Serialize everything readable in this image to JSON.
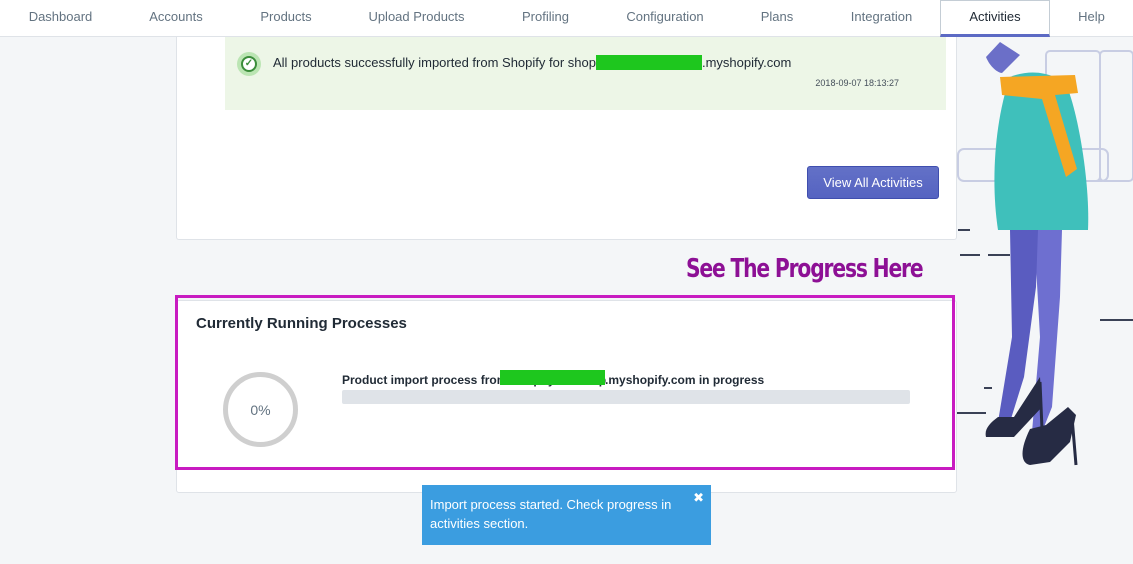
{
  "nav": {
    "items": [
      {
        "label": "Dashboard"
      },
      {
        "label": "Accounts"
      },
      {
        "label": "Products"
      },
      {
        "label": "Upload Products"
      },
      {
        "label": "Profiling"
      },
      {
        "label": "Configuration"
      },
      {
        "label": "Plans"
      },
      {
        "label": "Integration"
      },
      {
        "label": "Activities"
      },
      {
        "label": "Help"
      }
    ],
    "active": "Activities"
  },
  "activity": {
    "message_prefix": "All products successfully imported from Shopify for shop",
    "message_suffix": ".myshopify.com",
    "timestamp": "2018-09-07 18:13:27"
  },
  "view_all_label": "View All Activities",
  "callout": "See The Progress Here",
  "running": {
    "title": "Currently Running Processes",
    "percent_label": "0%",
    "progress": 0,
    "process_prefix": "Product import process from Shopify for shop",
    "process_suffix": ".myshopify.com in progress"
  },
  "toast": {
    "message": "Import process started. Check progress in activities section.",
    "close": "✖"
  },
  "colors": {
    "accent": "#5c6ac4",
    "success_bg": "#edf6e7",
    "highlight_border": "#c81bc1",
    "callout_text": "#8d1095",
    "toast_bg": "#3b9de0",
    "redaction": "#1ec71e"
  }
}
